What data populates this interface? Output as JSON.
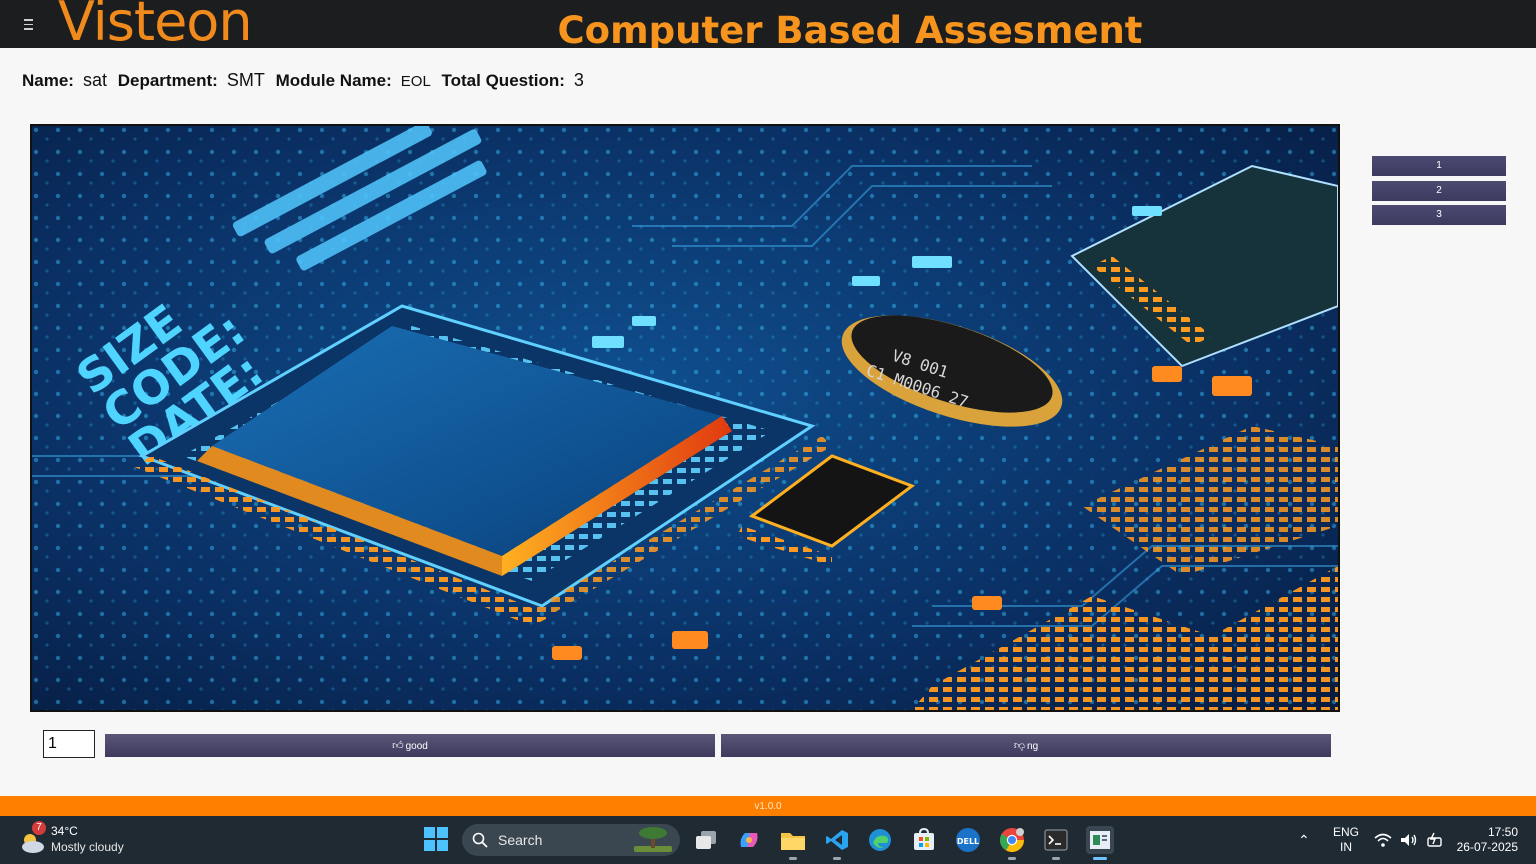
{
  "header": {
    "logo_text": "Visteon",
    "title": "Computer Based Assesment",
    "accent_color": "#f7941d",
    "menu_icon": "hamburger-menu-icon"
  },
  "info": {
    "name_label": "Name:",
    "name_value": "sat",
    "department_label": "Department:",
    "department_value": "SMT",
    "module_label": "Module Name:",
    "module_value": "EOL",
    "total_label": "Total Question:",
    "total_value": "3"
  },
  "question_image": {
    "alt": "circuit board",
    "silk_lines": [
      "SIZE",
      "CODE:",
      "DATE:"
    ],
    "crystal_text": [
      "V8 001",
      "C1 M0006 27"
    ]
  },
  "question_nav": [
    "1",
    "2",
    "3"
  ],
  "answer": {
    "input_value": "1",
    "good_label": "good",
    "good_icon": "thumbs-up-icon",
    "ng_label": "ng",
    "ng_icon": "thumbs-down-icon"
  },
  "version": "v1.0.0",
  "taskbar": {
    "weather_temp": "34°C",
    "weather_condition": "Mostly cloudy",
    "weather_badge": "7",
    "search_label": "Search",
    "lang_line1": "ENG",
    "lang_line2": "IN",
    "time": "17:50",
    "date": "26-07-2025",
    "apps": [
      "task-view",
      "copilot",
      "file-explorer",
      "vscode",
      "edge",
      "store",
      "dell",
      "chrome",
      "terminal",
      "assessment-app"
    ]
  }
}
